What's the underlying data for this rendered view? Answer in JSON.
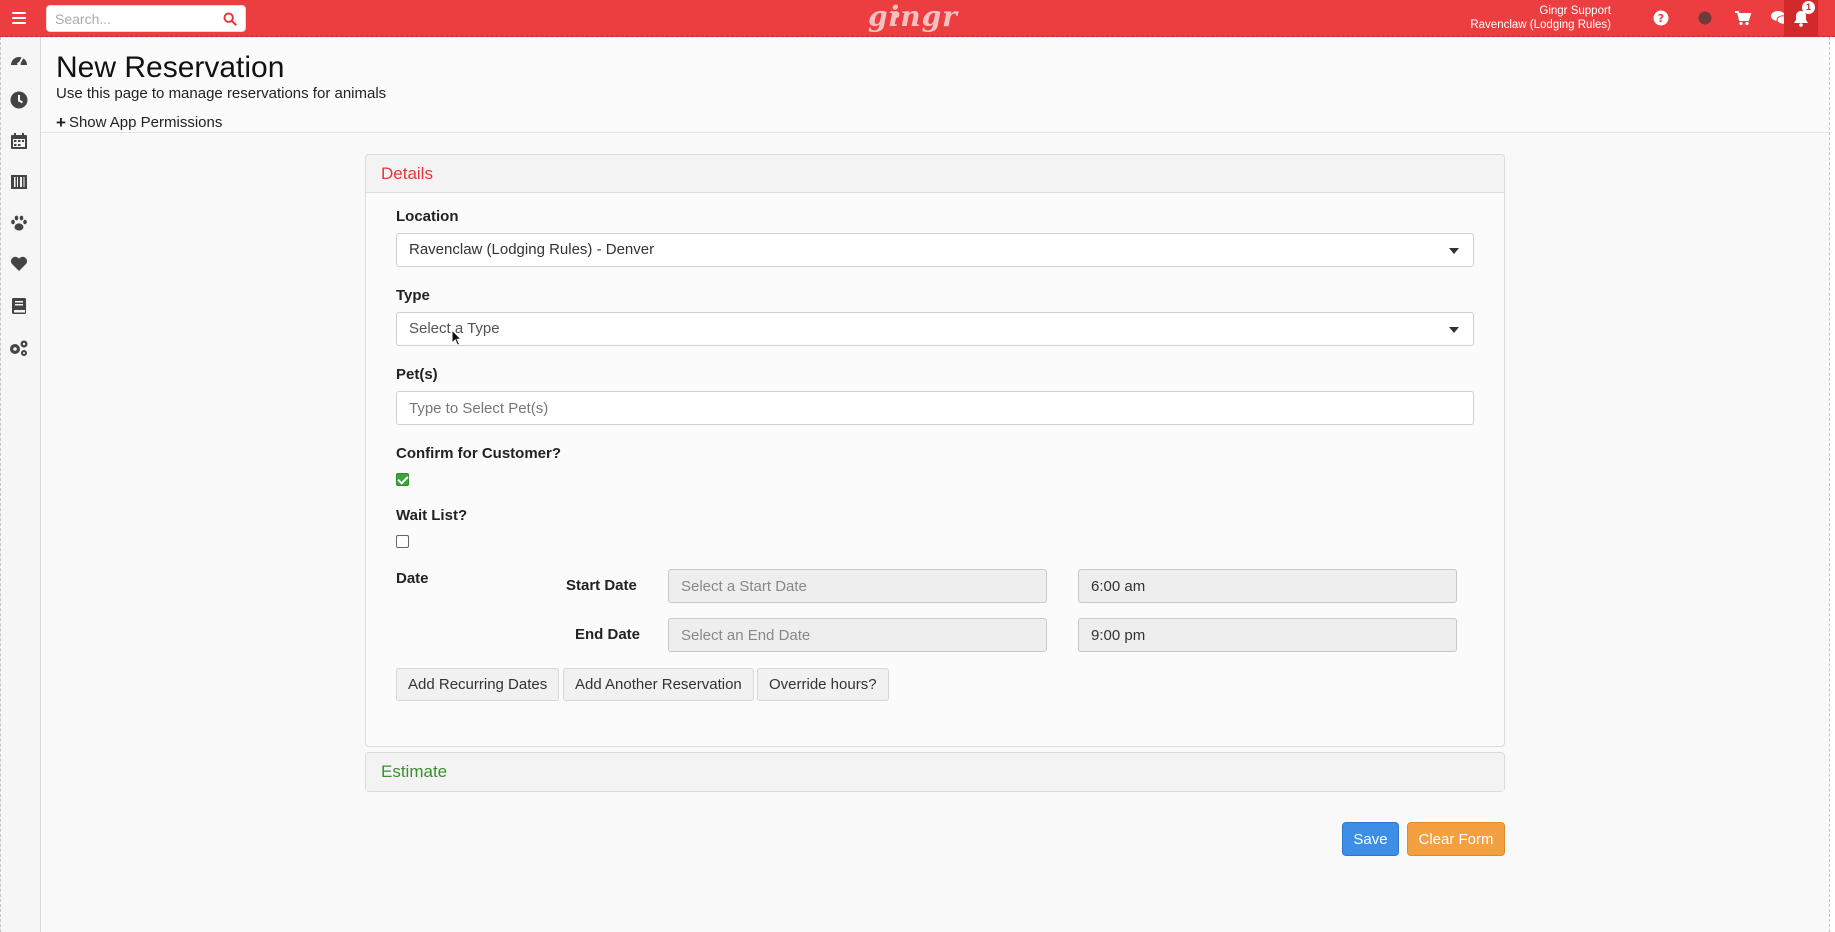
{
  "topbar": {
    "search_placeholder": "Search...",
    "logo_text": "gingr",
    "user_name": "Gingr Support",
    "user_location": "Ravenclaw (Lodging Rules)",
    "notification_count": "1",
    "icons": [
      "menu-icon",
      "search-icon",
      "help-icon",
      "status-dot-icon",
      "cart-icon",
      "chat-icon",
      "bell-icon"
    ],
    "brand_color": "#ec3e40"
  },
  "sidebar": {
    "icons": [
      "dashboard-icon",
      "clock-icon",
      "calendar-icon",
      "barcode-icon",
      "paw-icon",
      "heart-icon",
      "book-icon",
      "settings-icon"
    ]
  },
  "header": {
    "title": "New Reservation",
    "subtitle": "Use this page to manage reservations for animals",
    "permissions_link": "Show App Permissions"
  },
  "details": {
    "heading": "Details",
    "location_label": "Location",
    "location_value": "Ravenclaw (Lodging Rules) - Denver",
    "type_label": "Type",
    "type_placeholder": "Select a Type",
    "pets_label": "Pet(s)",
    "pets_placeholder": "Type to Select Pet(s)",
    "confirm_label": "Confirm for Customer?",
    "confirm_checked": true,
    "waitlist_label": "Wait List?",
    "waitlist_checked": false,
    "date_label": "Date",
    "start_date_label": "Start Date",
    "start_date_placeholder": "Select a Start Date",
    "start_time": "6:00 am",
    "end_date_label": "End Date",
    "end_date_placeholder": "Select an End Date",
    "end_time": "9:00 pm",
    "buttons": {
      "recurring": "Add Recurring Dates",
      "another": "Add Another Reservation",
      "override": "Override hours?"
    }
  },
  "estimate": {
    "heading": "Estimate"
  },
  "actions": {
    "save": "Save",
    "clear": "Clear Form"
  }
}
